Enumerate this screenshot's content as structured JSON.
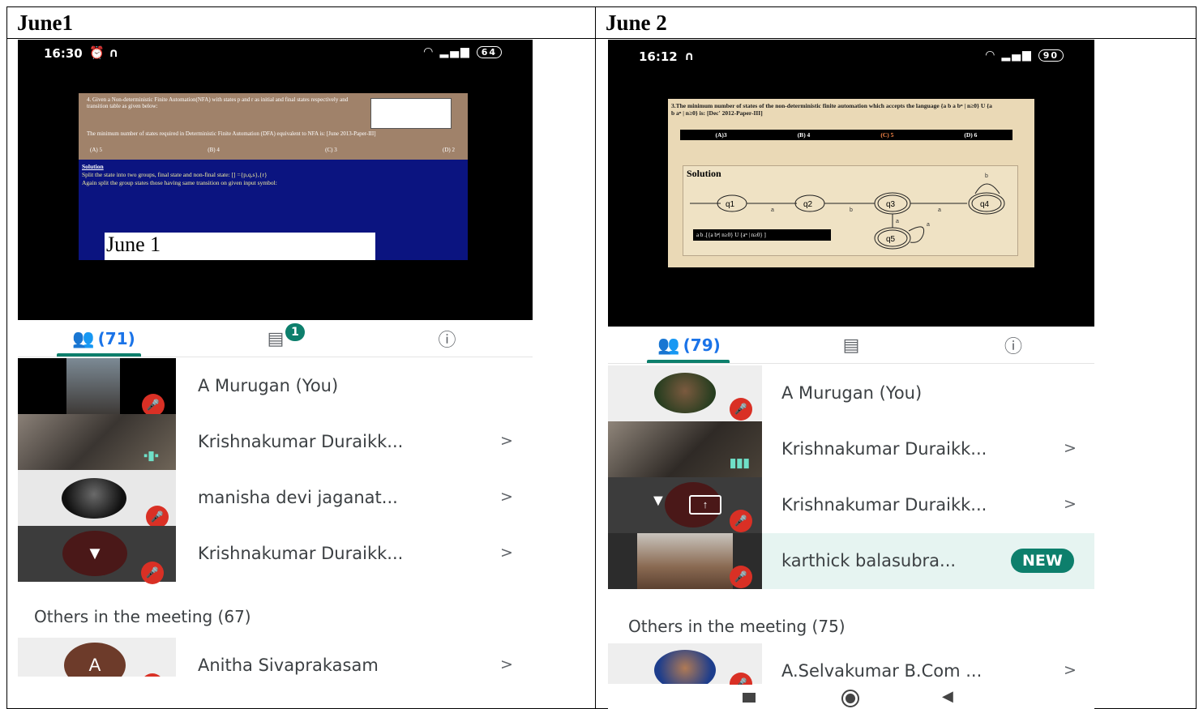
{
  "columns": [
    {
      "label": "June1",
      "status": {
        "time": "16:30",
        "battery": "64"
      },
      "slide": {
        "question": "4. Given a Non-deterministic Finite Automation(NFA) with states p and r as initial and final states respectively and transition table as given below:",
        "question_line2": "The minimum number of states required in Deterministic Finite Automation (DFA) equivalent to NFA is: [June 2013-Paper-III]",
        "options": [
          "(A) 5",
          "(B) 4",
          "(C) 3",
          "(D) 2"
        ],
        "solution_heading": "Solution",
        "solution_line1": "Split the state into two groups, final state and non-final state: [] ={p,q,s},{r}",
        "solution_line2": "Again split the group states those having same transition on given input symbol:",
        "overlay_label": "June 1"
      },
      "tabs": {
        "people_count": "(71)",
        "chat_badge": "1"
      },
      "participants": [
        {
          "name": "A Murugan (You)",
          "chevron": ""
        },
        {
          "name": "Krishnakumar Duraikk...",
          "chevron": ">"
        },
        {
          "name": "manisha devi jaganat...",
          "chevron": ">"
        },
        {
          "name": "Krishnakumar Duraikk...",
          "chevron": ">"
        }
      ],
      "others_header": "Others in the meeting (67)",
      "others": [
        {
          "name": "Anitha Sivaprakasam",
          "avatar_letter": "A",
          "chevron": ">"
        }
      ]
    },
    {
      "label": "June 2",
      "status": {
        "time": "16:12",
        "battery": "90"
      },
      "slide": {
        "question": "3.The minimum number of states of the non-deterministic finite automation which accepts the language {a b a bⁿ | n≥0} U {a b aⁿ | n≥0} is: [Dec' 2012-Paper-III]",
        "options": [
          "(A)3",
          "(B) 4",
          "(C) 5",
          "(D) 6"
        ],
        "solution_heading": "Solution",
        "language_box": "a b .[{a bⁿ| n≥0} U {aⁿ | n≥0} ]",
        "states": [
          "q1",
          "q2",
          "q3",
          "q4",
          "q5"
        ],
        "edge_labels": [
          "a",
          "b",
          "a",
          "b",
          "a",
          "a"
        ]
      },
      "tabs": {
        "people_count": "(79)"
      },
      "participants": [
        {
          "name": "A Murugan (You)",
          "chevron": ""
        },
        {
          "name": "Krishnakumar Duraikk...",
          "chevron": ">"
        },
        {
          "name": "Krishnakumar Duraikk...",
          "chevron": ">"
        },
        {
          "name": "karthick balasubra...",
          "chevron": "",
          "badge": "NEW"
        }
      ],
      "others_header": "Others in the meeting (75)",
      "others": [
        {
          "name": "A.Selvakumar B.Com ...",
          "chevron": ">"
        }
      ]
    }
  ],
  "colors": {
    "accent_teal": "#0d7f6c",
    "mute_red": "#d93025",
    "tab_blue": "#1a73e8",
    "highlight_row": "#e6f4f1"
  },
  "icons": [
    "people-icon",
    "chat-icon",
    "info-icon",
    "mic-off-icon",
    "audio-level-icon",
    "pin-icon",
    "present-icon",
    "alarm-icon",
    "headphones-icon",
    "wifi-icon",
    "signal-icon",
    "battery-icon",
    "nav-square-icon",
    "nav-home-icon",
    "nav-back-icon"
  ]
}
